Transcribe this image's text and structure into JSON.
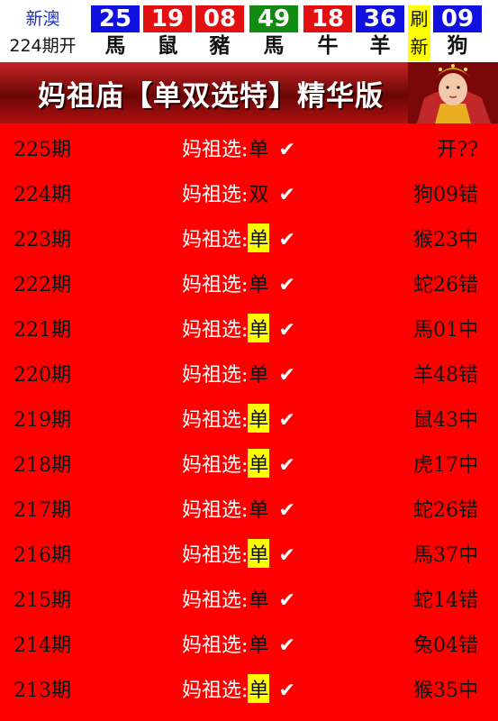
{
  "header": {
    "region": "新澳",
    "draw_period": "224期开",
    "refresh_label": "刷新",
    "balls": [
      {
        "number": "25",
        "zodiac": "馬",
        "color": "#1010e0"
      },
      {
        "number": "19",
        "zodiac": "鼠",
        "color": "#e21010"
      },
      {
        "number": "08",
        "zodiac": "豬",
        "color": "#e21010"
      },
      {
        "number": "49",
        "zodiac": "馬",
        "color": "#118a11"
      },
      {
        "number": "18",
        "zodiac": "牛",
        "color": "#e21010"
      },
      {
        "number": "36",
        "zodiac": "羊",
        "color": "#1010e0"
      },
      {
        "number": "09",
        "zodiac": "狗",
        "color": "#1010e0"
      }
    ]
  },
  "banner": {
    "title": "妈祖庙【单双选特】精华版"
  },
  "pick_prefix": "妈祖选:",
  "check_mark": "✔",
  "rows": [
    {
      "period": "225期",
      "choice": "单",
      "highlight": false,
      "result": "开??"
    },
    {
      "period": "224期",
      "choice": "双",
      "highlight": false,
      "result": "狗09错"
    },
    {
      "period": "223期",
      "choice": "单",
      "highlight": true,
      "result": "猴23中"
    },
    {
      "period": "222期",
      "choice": "单",
      "highlight": false,
      "result": "蛇26错"
    },
    {
      "period": "221期",
      "choice": "单",
      "highlight": true,
      "result": "馬01中"
    },
    {
      "period": "220期",
      "choice": "单",
      "highlight": false,
      "result": "羊48错"
    },
    {
      "period": "219期",
      "choice": "单",
      "highlight": true,
      "result": "鼠43中"
    },
    {
      "period": "218期",
      "choice": "单",
      "highlight": true,
      "result": "虎17中"
    },
    {
      "period": "217期",
      "choice": "单",
      "highlight": false,
      "result": "蛇26错"
    },
    {
      "period": "216期",
      "choice": "单",
      "highlight": true,
      "result": "馬37中"
    },
    {
      "period": "215期",
      "choice": "单",
      "highlight": false,
      "result": "蛇14错"
    },
    {
      "period": "214期",
      "choice": "单",
      "highlight": false,
      "result": "兔04错"
    },
    {
      "period": "213期",
      "choice": "单",
      "highlight": true,
      "result": "猴35中"
    }
  ]
}
